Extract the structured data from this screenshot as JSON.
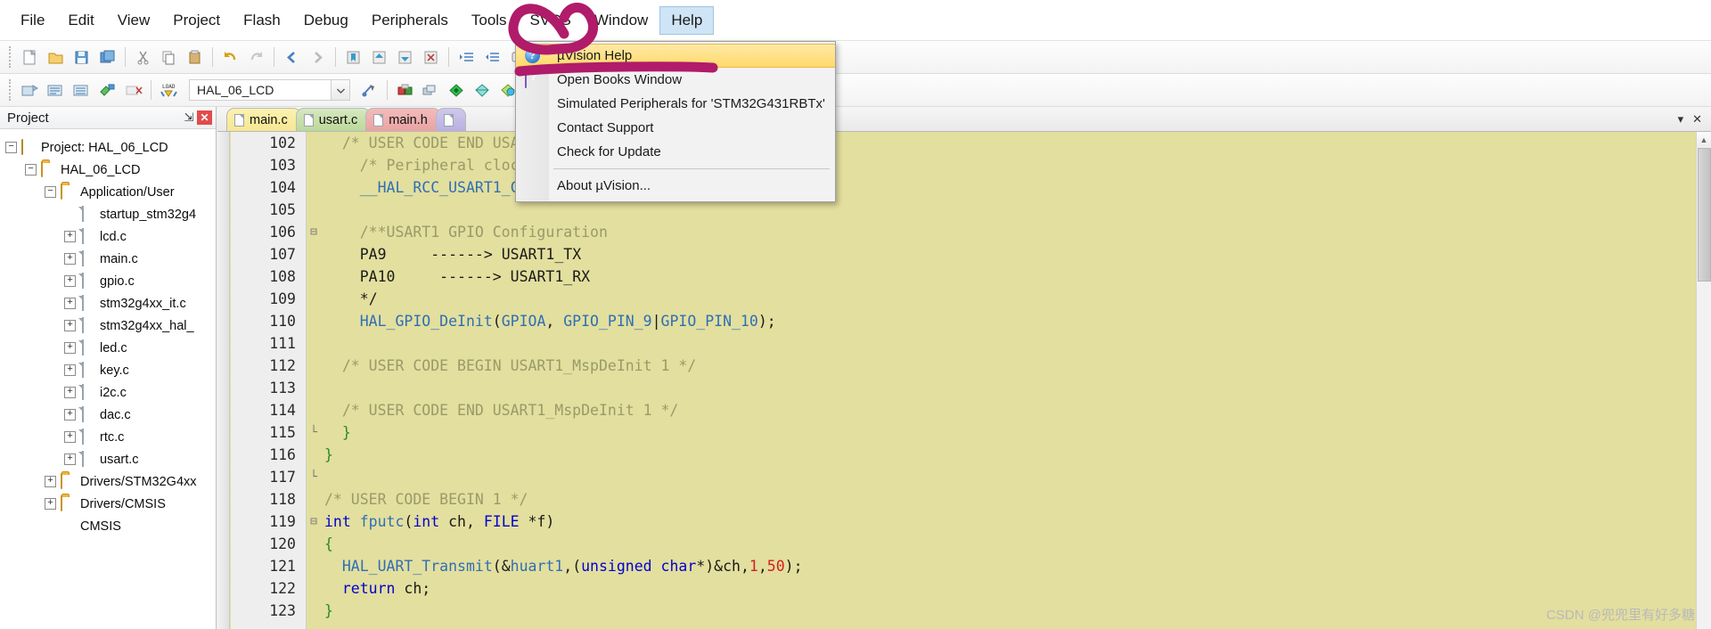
{
  "menubar": {
    "items": [
      {
        "label": "File",
        "active": false
      },
      {
        "label": "Edit",
        "active": false
      },
      {
        "label": "View",
        "active": false
      },
      {
        "label": "Project",
        "active": false
      },
      {
        "label": "Flash",
        "active": false
      },
      {
        "label": "Debug",
        "active": false
      },
      {
        "label": "Peripherals",
        "active": false
      },
      {
        "label": "Tools",
        "active": false
      },
      {
        "label": "SVCS",
        "active": false
      },
      {
        "label": "Window",
        "active": false
      },
      {
        "label": "Help",
        "active": true
      }
    ]
  },
  "toolbar": {
    "project_target": "HAL_06_LCD",
    "dropdown_arrow": "⌄"
  },
  "help_menu": {
    "items": [
      {
        "label": "µVision Help",
        "icon": "help-circle-icon",
        "highlight": true
      },
      {
        "label": "Open Books Window",
        "icon": "books-icon",
        "highlight": false
      },
      {
        "label": "Simulated Peripherals for 'STM32G431RBTx'",
        "icon": "",
        "highlight": false
      },
      {
        "label": "Contact Support",
        "icon": "",
        "highlight": false
      },
      {
        "label": "Check for Update",
        "icon": "",
        "highlight": false
      },
      {
        "label": "About µVision...",
        "icon": "",
        "highlight": false,
        "separator_before": true
      }
    ]
  },
  "project_panel": {
    "title": "Project",
    "pin_glyph": "⇲",
    "close_glyph": "✕",
    "tree": [
      {
        "label": "Project: HAL_06_LCD",
        "indent": 0,
        "expander": "−",
        "icon": "project-icon"
      },
      {
        "label": "HAL_06_LCD",
        "indent": 1,
        "expander": "−",
        "icon": "target-folder-icon"
      },
      {
        "label": "Application/User",
        "indent": 2,
        "expander": "−",
        "icon": "folder-icon"
      },
      {
        "label": "startup_stm32g4",
        "indent": 3,
        "expander": "",
        "icon": "doc-icon"
      },
      {
        "label": "lcd.c",
        "indent": 3,
        "expander": "+",
        "icon": "doc-icon"
      },
      {
        "label": "main.c",
        "indent": 3,
        "expander": "+",
        "icon": "doc-icon"
      },
      {
        "label": "gpio.c",
        "indent": 3,
        "expander": "+",
        "icon": "doc-gear-icon"
      },
      {
        "label": "stm32g4xx_it.c",
        "indent": 3,
        "expander": "+",
        "icon": "doc-icon"
      },
      {
        "label": "stm32g4xx_hal_",
        "indent": 3,
        "expander": "+",
        "icon": "doc-icon"
      },
      {
        "label": "led.c",
        "indent": 3,
        "expander": "+",
        "icon": "doc-icon"
      },
      {
        "label": "key.c",
        "indent": 3,
        "expander": "+",
        "icon": "doc-icon"
      },
      {
        "label": "i2c.c",
        "indent": 3,
        "expander": "+",
        "icon": "doc-icon"
      },
      {
        "label": "dac.c",
        "indent": 3,
        "expander": "+",
        "icon": "doc-icon"
      },
      {
        "label": "rtc.c",
        "indent": 3,
        "expander": "+",
        "icon": "doc-icon"
      },
      {
        "label": "usart.c",
        "indent": 3,
        "expander": "+",
        "icon": "doc-icon"
      },
      {
        "label": "Drivers/STM32G4xx",
        "indent": 2,
        "expander": "+",
        "icon": "folder-icon"
      },
      {
        "label": "Drivers/CMSIS",
        "indent": 2,
        "expander": "+",
        "icon": "folder-icon"
      },
      {
        "label": "CMSIS",
        "indent": 2,
        "expander": "",
        "icon": "cmsis-icon"
      }
    ]
  },
  "editor": {
    "tabs": [
      {
        "label": "main.c",
        "active": false
      },
      {
        "label": "usart.c",
        "active": true
      },
      {
        "label": "main.h",
        "active": false
      },
      {
        "label": "",
        "active": false
      }
    ],
    "restore_glyph": "▾",
    "close_glyph": "✕",
    "first_line": 102,
    "lines": [
      {
        "n": 102,
        "fold": "",
        "text": "  /* USER CODE END USART1_MspDeInit 0 */"
      },
      {
        "n": 103,
        "fold": "",
        "text": "    /* Peripheral clock disable */"
      },
      {
        "n": 104,
        "fold": "",
        "text": "    __HAL_RCC_USART1_CLK_DISABLE();"
      },
      {
        "n": 105,
        "fold": "",
        "text": ""
      },
      {
        "n": 106,
        "fold": "⊟",
        "text": "    /**USART1 GPIO Configuration"
      },
      {
        "n": 107,
        "fold": "",
        "text": "    PA9     ------> USART1_TX"
      },
      {
        "n": 108,
        "fold": "",
        "text": "    PA10     ------> USART1_RX"
      },
      {
        "n": 109,
        "fold": "",
        "text": "    */"
      },
      {
        "n": 110,
        "fold": "",
        "text": "    HAL_GPIO_DeInit(GPIOA, GPIO_PIN_9|GPIO_PIN_10);"
      },
      {
        "n": 111,
        "fold": "",
        "text": ""
      },
      {
        "n": 112,
        "fold": "",
        "text": "  /* USER CODE BEGIN USART1_MspDeInit 1 */"
      },
      {
        "n": 113,
        "fold": "",
        "text": ""
      },
      {
        "n": 114,
        "fold": "",
        "text": "  /* USER CODE END USART1_MspDeInit 1 */"
      },
      {
        "n": 115,
        "fold": "└",
        "text": "  }"
      },
      {
        "n": 116,
        "fold": "",
        "text": "}"
      },
      {
        "n": 117,
        "fold": "└",
        "text": ""
      },
      {
        "n": 118,
        "fold": "",
        "text": "/* USER CODE BEGIN 1 */"
      },
      {
        "n": 119,
        "fold": "⊟",
        "text": "int fputc(int ch, FILE *f)"
      },
      {
        "n": 120,
        "fold": "",
        "text": "{"
      },
      {
        "n": 121,
        "fold": "",
        "text": "  HAL_UART_Transmit(&huart1,(unsigned char*)&ch,1,50);"
      },
      {
        "n": 122,
        "fold": "",
        "text": "  return ch;"
      },
      {
        "n": 123,
        "fold": "",
        "text": "}"
      }
    ]
  },
  "watermark": "CSDN @兜兜里有好多糖",
  "colors": {
    "editor_background": "#e3df9e",
    "annotation": "#b01b6a",
    "menu_highlight": "#ffd968",
    "active_menu": "#cfe4f5"
  }
}
